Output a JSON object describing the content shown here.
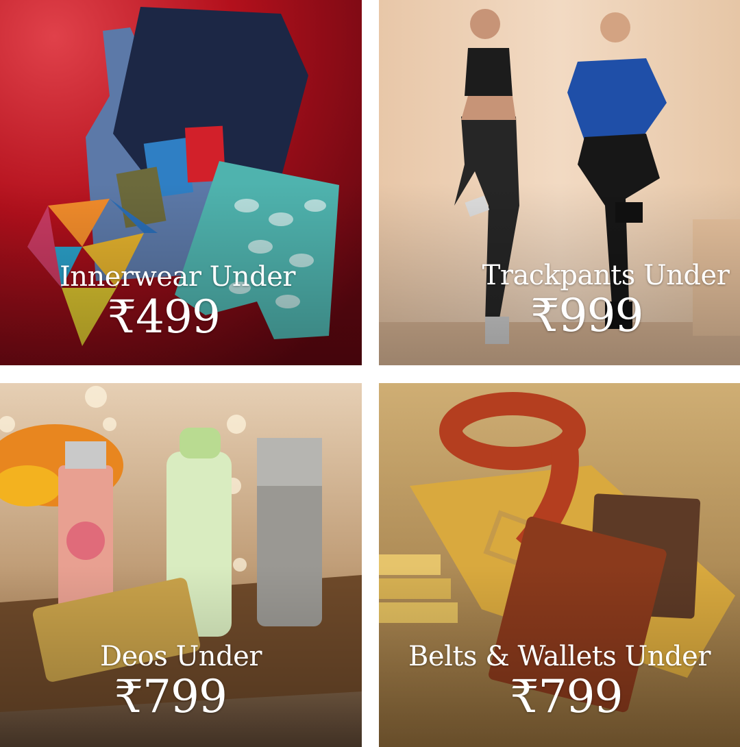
{
  "tiles": [
    {
      "id": "innerwear",
      "title": "Innerwear Under",
      "price": "₹499"
    },
    {
      "id": "trackpants",
      "title": "Trackpants Under",
      "price": "₹999"
    },
    {
      "id": "deos",
      "title": "Deos Under",
      "price": "₹799"
    },
    {
      "id": "belts-wallets",
      "title": "Belts & Wallets Under",
      "price": "₹799"
    }
  ],
  "colors": {
    "innerwear_bg": "#b0121e",
    "trackpants_bg": "#e9cdb2",
    "deos_bg": "#c9a27c",
    "belts_bg": "#caa46a",
    "text": "#ffffff"
  },
  "images": {
    "innerwear": "innerwear-product-photo",
    "trackpants": "athletes-trackpants-photo",
    "deos": "deodorant-bottles-photo",
    "belts_wallets": "belt-and-wallets-photo"
  }
}
